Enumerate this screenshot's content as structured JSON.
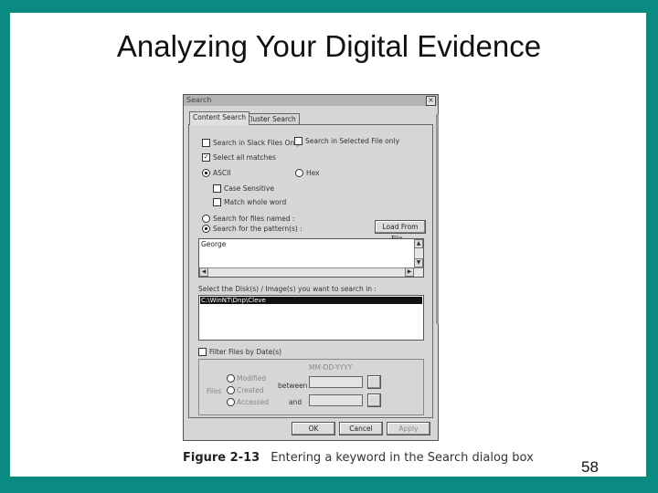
{
  "slide": {
    "title": "Analyzing Your Digital Evidence",
    "page_number": "58",
    "caption_figure": "Figure 2-13",
    "caption_text": "Entering a keyword in the Search dialog box"
  },
  "colors": {
    "frame": "#0b8a83"
  },
  "dialog": {
    "title": "Search",
    "close_glyph": "×",
    "tabs": [
      {
        "label": "Content Search",
        "active": true
      },
      {
        "label": "Cluster Search",
        "active": false
      }
    ],
    "options": {
      "slack_only": "Search in Slack Files Only",
      "selected_files_only": "Search in Selected File only",
      "select_matches": "Select all matches",
      "ascii": "ASCII",
      "hex": "Hex",
      "case_sensitive": "Case Sensitive",
      "whole_word": "Match whole word",
      "search_files_named": "Search for files named :",
      "search_pattern": "Search for the pattern(s) :"
    },
    "load_button": "Load From File...",
    "pattern_value": "George",
    "drives_label": "Select the Disk(s) / Image(s) you want to search in :",
    "drives": [
      "C:\\WinNT\\Dnp\\Cleve"
    ],
    "filter_dates": "Filter Files by Date(s)",
    "date_format": "MM-DD-YYYY",
    "files_label": "Files",
    "date_kinds": [
      "Modified",
      "Created",
      "Accessed"
    ],
    "between_label": "between",
    "and_label": "and",
    "buttons": {
      "ok": "OK",
      "cancel": "Cancel",
      "apply": "Apply"
    }
  }
}
